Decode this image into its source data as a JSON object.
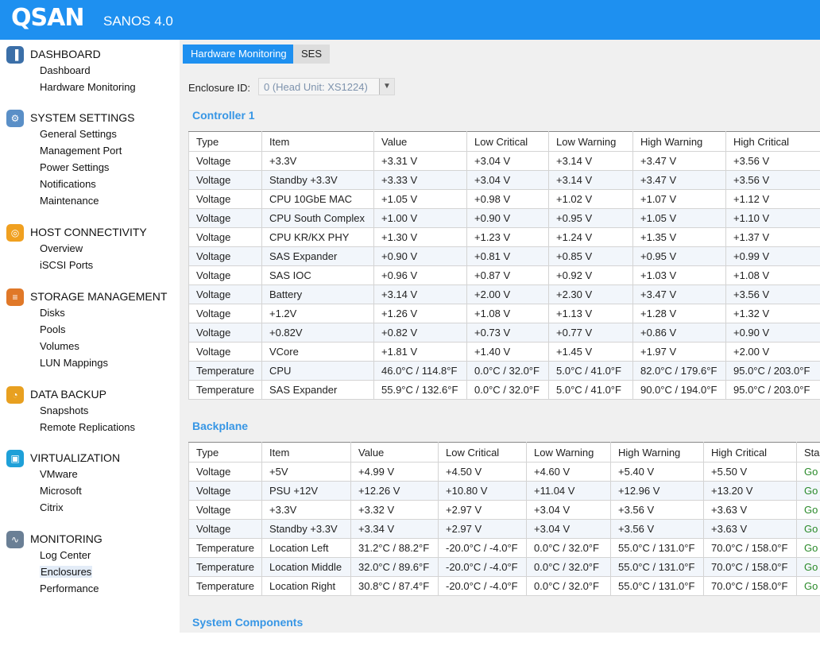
{
  "header": {
    "logo": "QSAN",
    "product": "SANOS 4.0"
  },
  "sidebar": [
    {
      "title": "DASHBOARD",
      "icon": "dashboard-icon",
      "items": [
        "Dashboard",
        "Hardware Monitoring"
      ]
    },
    {
      "title": "SYSTEM SETTINGS",
      "icon": "system-settings-icon",
      "items": [
        "General Settings",
        "Management Port",
        "Power Settings",
        "Notifications",
        "Maintenance"
      ]
    },
    {
      "title": "HOST CONNECTIVITY",
      "icon": "host-connectivity-icon",
      "items": [
        "Overview",
        "iSCSI Ports"
      ]
    },
    {
      "title": "STORAGE MANAGEMENT",
      "icon": "storage-management-icon",
      "items": [
        "Disks",
        "Pools",
        "Volumes",
        "LUN Mappings"
      ]
    },
    {
      "title": "DATA BACKUP",
      "icon": "data-backup-icon",
      "items": [
        "Snapshots",
        "Remote Replications"
      ]
    },
    {
      "title": "VIRTUALIZATION",
      "icon": "virtualization-icon",
      "items": [
        "VMware",
        "Microsoft",
        "Citrix"
      ]
    },
    {
      "title": "MONITORING",
      "icon": "monitoring-icon",
      "items": [
        "Log Center",
        "Enclosures",
        "Performance"
      ]
    }
  ],
  "active_item": "Enclosures",
  "tabs": [
    "Hardware Monitoring",
    "SES"
  ],
  "enclosure": {
    "label": "Enclosure ID:",
    "value": "0 (Head Unit: XS1224)"
  },
  "controller": {
    "title": "Controller 1",
    "columns": [
      "Type",
      "Item",
      "Value",
      "Low Critical",
      "Low Warning",
      "High Warning",
      "High Critical"
    ],
    "rows": [
      [
        "Voltage",
        "+3.3V",
        "+3.31 V",
        "+3.04 V",
        "+3.14 V",
        "+3.47 V",
        "+3.56 V"
      ],
      [
        "Voltage",
        "Standby +3.3V",
        "+3.33 V",
        "+3.04 V",
        "+3.14 V",
        "+3.47 V",
        "+3.56 V"
      ],
      [
        "Voltage",
        "CPU 10GbE MAC",
        "+1.05 V",
        "+0.98 V",
        "+1.02 V",
        "+1.07 V",
        "+1.12 V"
      ],
      [
        "Voltage",
        "CPU South Complex",
        "+1.00 V",
        "+0.90 V",
        "+0.95 V",
        "+1.05 V",
        "+1.10 V"
      ],
      [
        "Voltage",
        "CPU KR/KX PHY",
        "+1.30 V",
        "+1.23 V",
        "+1.24 V",
        "+1.35 V",
        "+1.37 V"
      ],
      [
        "Voltage",
        "SAS Expander",
        "+0.90 V",
        "+0.81 V",
        "+0.85 V",
        "+0.95 V",
        "+0.99 V"
      ],
      [
        "Voltage",
        "SAS IOC",
        "+0.96 V",
        "+0.87 V",
        "+0.92 V",
        "+1.03 V",
        "+1.08 V"
      ],
      [
        "Voltage",
        "Battery",
        "+3.14 V",
        "+2.00 V",
        "+2.30 V",
        "+3.47 V",
        "+3.56 V"
      ],
      [
        "Voltage",
        "+1.2V",
        "+1.26 V",
        "+1.08 V",
        "+1.13 V",
        "+1.28 V",
        "+1.32 V"
      ],
      [
        "Voltage",
        "+0.82V",
        "+0.82 V",
        "+0.73 V",
        "+0.77 V",
        "+0.86 V",
        "+0.90 V"
      ],
      [
        "Voltage",
        "VCore",
        "+1.81 V",
        "+1.40 V",
        "+1.45 V",
        "+1.97 V",
        "+2.00 V"
      ],
      [
        "Temperature",
        "CPU",
        "46.0°C / 114.8°F",
        "0.0°C / 32.0°F",
        "5.0°C / 41.0°F",
        "82.0°C / 179.6°F",
        "95.0°C / 203.0°F"
      ],
      [
        "Temperature",
        "SAS Expander",
        "55.9°C / 132.6°F",
        "0.0°C / 32.0°F",
        "5.0°C / 41.0°F",
        "90.0°C / 194.0°F",
        "95.0°C / 203.0°F"
      ]
    ]
  },
  "backplane": {
    "title": "Backplane",
    "columns": [
      "Type",
      "Item",
      "Value",
      "Low Critical",
      "Low Warning",
      "High Warning",
      "High Critical",
      "Sta"
    ],
    "rows": [
      [
        "Voltage",
        "+5V",
        "+4.99 V",
        "+4.50 V",
        "+4.60 V",
        "+5.40 V",
        "+5.50 V",
        "Go"
      ],
      [
        "Voltage",
        "PSU +12V",
        "+12.26 V",
        "+10.80 V",
        "+11.04 V",
        "+12.96 V",
        "+13.20 V",
        "Go"
      ],
      [
        "Voltage",
        "+3.3V",
        "+3.32 V",
        "+2.97 V",
        "+3.04 V",
        "+3.56 V",
        "+3.63 V",
        "Go"
      ],
      [
        "Voltage",
        "Standby +3.3V",
        "+3.34 V",
        "+2.97 V",
        "+3.04 V",
        "+3.56 V",
        "+3.63 V",
        "Go"
      ],
      [
        "Temperature",
        "Location Left",
        "31.2°C / 88.2°F",
        "-20.0°C / -4.0°F",
        "0.0°C / 32.0°F",
        "55.0°C / 131.0°F",
        "70.0°C / 158.0°F",
        "Go"
      ],
      [
        "Temperature",
        "Location Middle",
        "32.0°C / 89.6°F",
        "-20.0°C / -4.0°F",
        "0.0°C / 32.0°F",
        "55.0°C / 131.0°F",
        "70.0°C / 158.0°F",
        "Go"
      ],
      [
        "Temperature",
        "Location Right",
        "30.8°C / 87.4°F",
        "-20.0°C / -4.0°F",
        "0.0°C / 32.0°F",
        "55.0°C / 131.0°F",
        "70.0°C / 158.0°F",
        "Go"
      ]
    ]
  },
  "system_components": {
    "title": "System Components"
  },
  "colors": {
    "brand": "#1e90f0",
    "section_heading": "#3796e5",
    "status_good": "#2a8a2a"
  }
}
